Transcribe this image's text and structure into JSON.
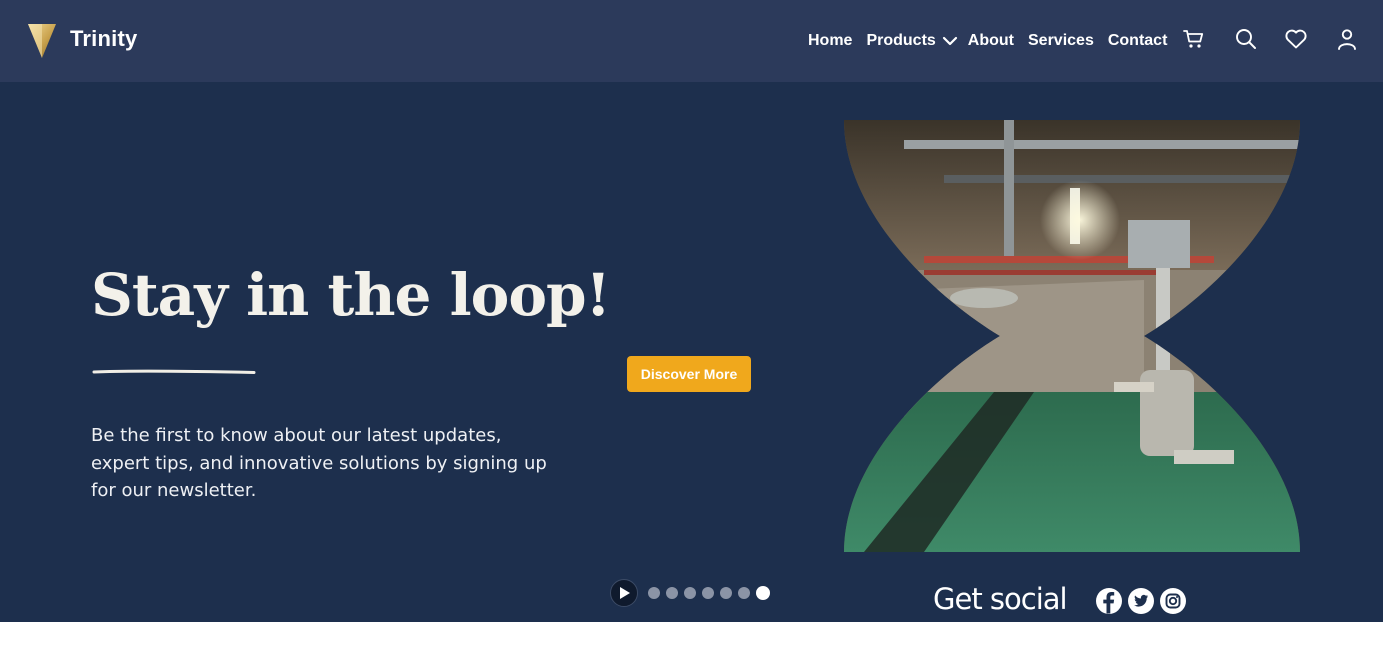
{
  "brand": {
    "name": "Trinity",
    "logo_icon": "triangle-logo-icon",
    "accent": "#e9c77b"
  },
  "nav": {
    "items": [
      {
        "label": "Home"
      },
      {
        "label": "Products",
        "has_dropdown": true
      },
      {
        "label": "About"
      },
      {
        "label": "Services"
      },
      {
        "label": "Contact"
      }
    ],
    "icons": [
      "cart-icon",
      "search-icon",
      "heart-icon",
      "user-icon"
    ]
  },
  "hero": {
    "headline": "Stay in the loop!",
    "body": "Be the first to know about our latest updates, expert tips, and innovative solutions by signing up for our newsletter.",
    "cta_label": "Discover More",
    "background": "#1d2f4d",
    "cta_color": "#f0a81c",
    "image": "hourglass-shaped photo of a basement utility room with pipes and green floor"
  },
  "carousel": {
    "slide_count": 7,
    "active_index": 6,
    "play_icon": "play-icon"
  },
  "social": {
    "label": "Get social",
    "networks": [
      "facebook-icon",
      "twitter-icon",
      "instagram-icon"
    ]
  }
}
